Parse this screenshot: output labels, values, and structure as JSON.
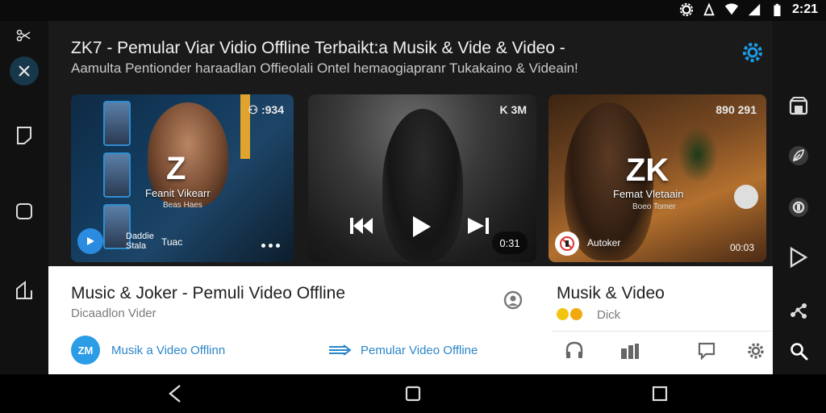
{
  "status": {
    "time": "2:21"
  },
  "header": {
    "title": "ZK7 - Pemular Viar Vidio Offline Terbaikt:a Musik & Vide & Video -",
    "subtitle": "Aamulta Pentionder haraadlan Offieolali Ontel hemaogiapranr Tukakaino & Videain!"
  },
  "cards": [
    {
      "corner": "⚇ :934",
      "brand": "Z",
      "brand_sub": "Feanit Vikearr",
      "brand_sub2": "Beas Haes",
      "bottom_left_text": "Daddie\nStala",
      "bottom_mid_text": "Tuac"
    },
    {
      "corner": "K 3M",
      "pill_text": "0:31"
    },
    {
      "corner": "890 291",
      "brand": "ZK",
      "brand_sub": "Femat Vletaain",
      "brand_sub2": "Boeo Tomer",
      "bottom_left_text": "Autoker",
      "bottom_right_text": "00:03"
    }
  ],
  "panel_left": {
    "title": "Music & Joker - Pemuli Video Offline",
    "subtitle": "Dicaadlon Vider",
    "badge": "ZM",
    "link1": "Musik a Video Offlinn",
    "link2": "Pemular Video Offline"
  },
  "panel_right": {
    "title": "Musik & Video",
    "subtitle": "Dick"
  },
  "colors": {
    "accent": "#2b86c9",
    "gear": "#1e9be6"
  },
  "icons": {
    "left_rail": [
      "scissors-icon",
      "close-icon",
      "bookmark-icon",
      "square-icon",
      "home-icon"
    ],
    "right_rail": [
      "store-icon",
      "leaf-icon",
      "record-icon",
      "play-store-icon",
      "share-icon",
      "search-icon"
    ],
    "nav": [
      "back-icon",
      "home-icon",
      "recents-icon"
    ]
  }
}
